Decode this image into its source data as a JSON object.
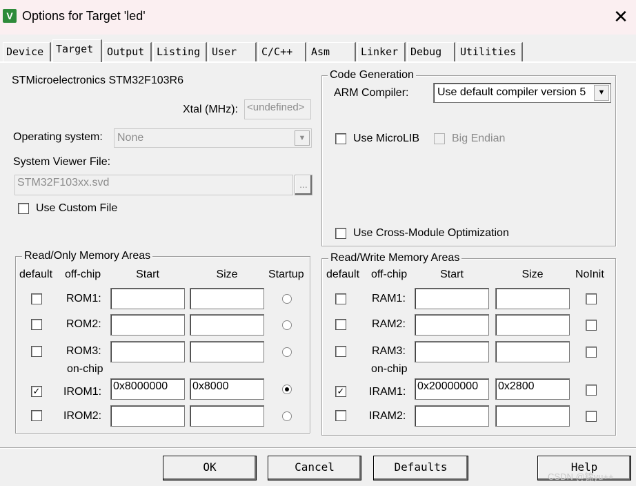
{
  "window": {
    "title": "Options for Target 'led'",
    "close_label": "✕"
  },
  "tabs": [
    "Device",
    "Target",
    "Output",
    "Listing",
    "User",
    "C/C++",
    "Asm",
    "Linker",
    "Debug",
    "Utilities"
  ],
  "active_tab": "Target",
  "device": {
    "name": "STMicroelectronics STM32F103R6",
    "xtal_label": "Xtal (MHz):",
    "xtal_value": "<undefined>",
    "os_label": "Operating system:",
    "os_value": "None",
    "svf_label": "System Viewer File:",
    "svf_value": "STM32F103xx.svd",
    "browse_label": "...",
    "custom_file_label": "Use Custom File",
    "custom_file_checked": false
  },
  "code_generation": {
    "title": "Code Generation",
    "compiler_label": "ARM Compiler:",
    "compiler_value": "Use default compiler version 5",
    "microlib_label": "Use MicroLIB",
    "microlib_checked": false,
    "big_endian_label": "Big Endian",
    "big_endian_checked": false,
    "cross_module_label": "Use Cross-Module Optimization",
    "cross_module_checked": false
  },
  "ro_memory": {
    "title": "Read/Only Memory Areas",
    "headers": {
      "default": "default",
      "offchip": "off-chip",
      "start": "Start",
      "size": "Size",
      "startup": "Startup"
    },
    "onchip_label": "on-chip",
    "rows": [
      {
        "name": "ROM1:",
        "default": false,
        "start": "",
        "size": "",
        "startup": false
      },
      {
        "name": "ROM2:",
        "default": false,
        "start": "",
        "size": "",
        "startup": false
      },
      {
        "name": "ROM3:",
        "default": false,
        "start": "",
        "size": "",
        "startup": false
      },
      {
        "name": "IROM1:",
        "default": true,
        "start": "0x8000000",
        "size": "0x8000",
        "startup": true
      },
      {
        "name": "IROM2:",
        "default": false,
        "start": "",
        "size": "",
        "startup": false
      }
    ]
  },
  "rw_memory": {
    "title": "Read/Write Memory Areas",
    "headers": {
      "default": "default",
      "offchip": "off-chip",
      "start": "Start",
      "size": "Size",
      "noinit": "NoInit"
    },
    "onchip_label": "on-chip",
    "rows": [
      {
        "name": "RAM1:",
        "default": false,
        "start": "",
        "size": "",
        "noinit": false
      },
      {
        "name": "RAM2:",
        "default": false,
        "start": "",
        "size": "",
        "noinit": false
      },
      {
        "name": "RAM3:",
        "default": false,
        "start": "",
        "size": "",
        "noinit": false
      },
      {
        "name": "IRAM1:",
        "default": true,
        "start": "0x20000000",
        "size": "0x2800",
        "noinit": false
      },
      {
        "name": "IRAM2:",
        "default": false,
        "start": "",
        "size": "",
        "noinit": false
      }
    ]
  },
  "buttons": {
    "ok": "OK",
    "cancel": "Cancel",
    "defaults": "Defaults",
    "help": "Help"
  },
  "watermark": "CSDN @锦yu++",
  "icons": {
    "app": "keil-uvision-icon",
    "check": "✓"
  }
}
